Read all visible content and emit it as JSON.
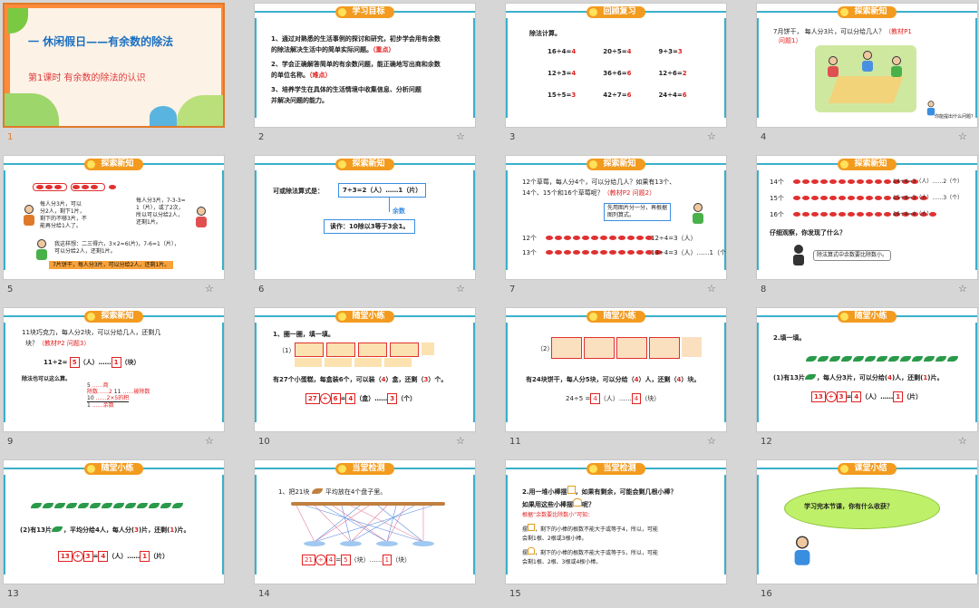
{
  "slides": {
    "s1": {
      "number": "1",
      "title": "一 休闲假日——有余数的除法",
      "subtitle": "第1课时    有余数的除法的认识"
    },
    "s2": {
      "number": "2",
      "badge": "学习目标",
      "lines": [
        "1、通过对熟悉的生活事例的探讨和研究，初步学会用有余数",
        "的除法解决生活中的简单实际问题。",
        "（重点）",
        "2、学会正确解答简单的有余数问题，能正确地写出商和余数",
        "的单位名称。",
        "（难点）",
        "3、培养学生在具体的生活情境中收集信息、分析问题",
        "并解决问题的能力。"
      ]
    },
    "s3": {
      "number": "3",
      "badge": "回顾复习",
      "heading": "除法计算。",
      "rows": [
        [
          "16÷4=",
          "4",
          "20÷5=",
          "4",
          "9÷3=",
          "3"
        ],
        [
          "12÷3=",
          "4",
          "36÷6=",
          "6",
          "12÷6=",
          "2"
        ],
        [
          "15÷5=",
          "3",
          "42÷7=",
          "6",
          "24÷4=",
          "6"
        ]
      ]
    },
    "s4": {
      "number": "4",
      "badge": "探索新知",
      "q1": "7月饼干，  每人分3片，可以分给几人？",
      "q1ref": "（教材P1",
      "q2ref": "问题1）",
      "caption": "你能提出什么问题？"
    },
    "s5": {
      "number": "5",
      "badge": "探索新知",
      "a1": "每人分3片，可以",
      "a2": "分2人，剩下1片，",
      "a3": "剩下的不够3片，不",
      "a4": "能再分给1人了。",
      "b1": "每人分3片，7-3-3=",
      "b2": "1（片），或了2次，",
      "b3": "所以可以分给2人，",
      "b4": "还剩1片。",
      "c1": "我这样想：二三得六，3×2=6(片)，7-6=1（片），",
      "c2": "可以分给2人，还剩1片。",
      "result": "7片饼干，每人分3片，可以分给2人，还剩1片。"
    },
    "s6": {
      "number": "6",
      "badge": "探索新知",
      "label": "可或除法算式是：",
      "equation": "7÷3=2（人）……1（片）",
      "remainder": "余数",
      "reading": "读作：10除以3等于3余1。"
    },
    "s7": {
      "number": "7",
      "badge": "探索新知",
      "q1": "12个草莓，每人分4个，可以分给几人？如果有13个、",
      "q2": "14个、15个和16个草莓呢？",
      "ref": "（教材P2 问题2）",
      "hint1": "先用图片分一分，再根据",
      "hint2": "图列算式。",
      "r1label": "12个",
      "r1eq": "12÷4=3（人）",
      "r2label": "13个",
      "r2eq": "13÷4=3（人）……1（个）"
    },
    "s8": {
      "number": "8",
      "badge": "探索新知",
      "rows": [
        [
          "14个",
          "14÷4=3（人）……2（个）"
        ],
        [
          "15个",
          "15÷4=3（人）……3（个）"
        ],
        [
          "16个",
          "16÷4=4（人）"
        ]
      ],
      "question": "仔细观察，你发现了什么？",
      "hint": "除法算式中余数要比除数小。"
    },
    "s9": {
      "number": "9",
      "badge": "探索新知",
      "q1": "11块巧克力，每人分2块，可以分给几人，还剩几",
      "q2": "块？",
      "ref": "（教材P2  问题3）",
      "eq": "11÷2=",
      "a1": "5",
      "unit1": "（人）……",
      "a2": "1",
      "unit2": "（块）",
      "note": "除法也可以这么算。",
      "v1": "5",
      "v1n": "……商",
      "v2": "11",
      "v2n": "……被除数",
      "v3": "10",
      "v3n": "……2×5的积",
      "v4": "1",
      "v4n": "……余数",
      "divisor": "除数……2"
    },
    "s10": {
      "number": "10",
      "badge": "随堂小练",
      "title": "1、圈一圈，填一填。",
      "label": "（1）",
      "sentence1": "有27个小蛋糕，每盒装6个，可以装（",
      "a1": "4",
      "sentence2": "）盒，还剩（",
      "a2": "3",
      "sentence3": "）个。",
      "f1": "27",
      "op": "÷",
      "f2": "6",
      "eq": "=",
      "f3": "4",
      "u1": "（盒）……",
      "f4": "3",
      "u2": "（个）"
    },
    "s11": {
      "number": "11",
      "badge": "随堂小练",
      "label": "（2）",
      "sentence1": "有24块饼干，每人分5块，可以分给（",
      "a1": "4",
      "sentence2": "）人，还剩（",
      "a2": "4",
      "sentence3": "）块。",
      "eqL": "24÷5 =",
      "f1": "4",
      "u1": "（人）……",
      "f2": "4",
      "u2": "（块）"
    },
    "s12": {
      "number": "12",
      "badge": "随堂小练",
      "title": "2.填一填。",
      "sentence1": "(1)有13片",
      "sentence2": "，每人分3片，可以分给(",
      "a1": "4",
      "sentence3": ")人，还剩(",
      "a2": "1",
      "sentence4": ")片。",
      "f1": "13",
      "op": "÷",
      "f2": "3",
      "eq": "=",
      "f3": "4",
      "u1": "（人）……",
      "f4": "1",
      "u2": "（片）"
    },
    "s13": {
      "number": "13",
      "badge": "随堂小练",
      "sentence1": "(2)有13片",
      "sentence2": "，平均分给4人，每人分(",
      "a1": "3",
      "sentence3": ")片，还剩(",
      "a2": "1",
      "sentence4": ")片。",
      "f1": "13",
      "op": "÷",
      "f2": "3",
      "eq": "=",
      "f3": "4",
      "u1": "（人）……",
      "f4": "1",
      "u2": "（片）"
    },
    "s14": {
      "number": "14",
      "badge": "当堂检测",
      "title": "1、把21块",
      "title2": "平均放在4个盘子里。",
      "f1": "21",
      "op": "÷",
      "f2": "4",
      "eq": "=",
      "f3": "5",
      "u1": "（块）……",
      "f4": "1",
      "u2": "（块）"
    },
    "s15": {
      "number": "15",
      "badge": "当堂检测",
      "l1": "2.用一堆小棒摆",
      "l1b": "，如果有剩余，可能会剩几根小棒？",
      "l2": "如果用这些小棒摆",
      "l2b": "呢？",
      "l3": "根据“余数要比除数小”可知：",
      "l4": "摆",
      "l4b": "，剩下的小棒的根数不能大于或等于4，所以，可能",
      "l5": "会剩1根、2根或3根小棒。",
      "l6": "摆",
      "l6b": "，剩下的小棒的根数不能大于或等于5，所以，可能",
      "l7": "会剩1根、2根、3根或4根小棒。"
    },
    "s16": {
      "number": "16",
      "badge": "课堂小结",
      "bubble": "学习完本节课，你有什么收获？"
    }
  },
  "colors": {
    "accent": "#3bb0c9",
    "badge": "#f39b1f",
    "answer": "#e02020",
    "selected_border": "#e07a2a"
  },
  "icons": {
    "favorite": "star-outline-icon"
  }
}
